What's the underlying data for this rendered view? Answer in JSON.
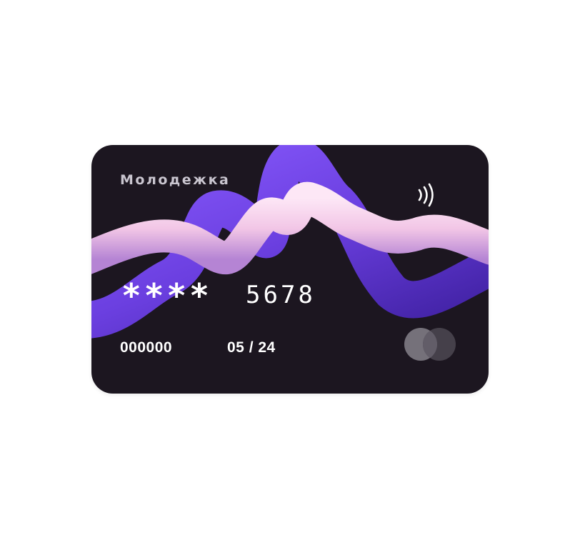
{
  "card": {
    "brand": "Молодежка",
    "masked_digits": "****",
    "last_four": "5678",
    "account_number": "000000",
    "expiry": "05 / 24",
    "payment_network_icon": "mastercard-style-circles-icon",
    "contactless_icon": "contactless-payment-icon",
    "colors": {
      "card_background": "#1c1620",
      "purple_wave": "#6b3fe0",
      "pink_wave": "#f2c6e6",
      "text": "#ffffff"
    }
  }
}
